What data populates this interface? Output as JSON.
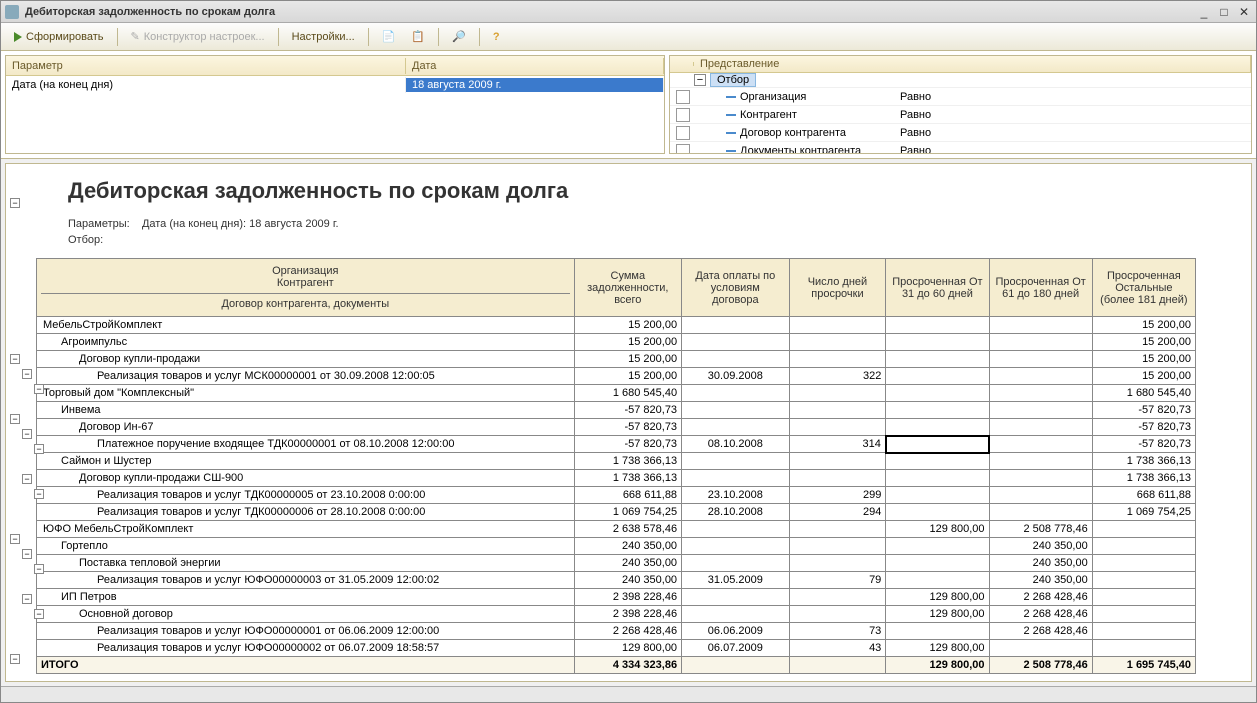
{
  "window": {
    "title": "Дебиторская задолженность по срокам долга"
  },
  "toolbar": {
    "generate": "Сформировать",
    "constructor": "Конструктор настроек...",
    "settings": "Настройки..."
  },
  "params": {
    "header_param": "Параметр",
    "header_date": "Дата",
    "row_label": "Дата (на конец дня)",
    "row_value": "18 августа 2009 г."
  },
  "filters": {
    "header": "Представление",
    "root": "Отбор",
    "items": [
      {
        "label": "Организация",
        "op": "Равно"
      },
      {
        "label": "Контрагент",
        "op": "Равно"
      },
      {
        "label": "Договор контрагента",
        "op": "Равно"
      },
      {
        "label": "Документы контрагента",
        "op": "Равно"
      }
    ]
  },
  "report": {
    "title": "Дебиторская задолженность по срокам долга",
    "params_label": "Параметры:",
    "params_text": "Дата (на конец дня): 18 августа 2009 г.",
    "filter_label": "Отбор:",
    "col_org": "Организация",
    "col_contr": "Контрагент",
    "col_dogdoc": "Договор контрагента, документы",
    "col_sum": "Сумма задолженности, всего",
    "col_paydate": "Дата оплаты по условиям договора",
    "col_days": "Число дней просрочки",
    "col_31_60": "Просроченная От 31 до 60 дней",
    "col_61_180": "Просроченная От 61 до 180 дней",
    "col_rest": "Просроченная Остальные (более 181 дней)",
    "rows": [
      {
        "name": "МебельСтройКомплект",
        "sum": "15 200,00",
        "date": "",
        "days": "",
        "c1": "",
        "c2": "",
        "c3": "15 200,00",
        "ind": 0
      },
      {
        "name": "Агроимпульс",
        "sum": "15 200,00",
        "date": "",
        "days": "",
        "c1": "",
        "c2": "",
        "c3": "15 200,00",
        "ind": 1
      },
      {
        "name": "Договор купли-продажи",
        "sum": "15 200,00",
        "date": "",
        "days": "",
        "c1": "",
        "c2": "",
        "c3": "15 200,00",
        "ind": 2
      },
      {
        "name": "Реализация товаров и услуг МСК00000001 от 30.09.2008 12:00:05",
        "sum": "15 200,00",
        "date": "30.09.2008",
        "days": "322",
        "c1": "",
        "c2": "",
        "c3": "15 200,00",
        "ind": 3
      },
      {
        "name": "Торговый дом \"Комплексный\"",
        "sum": "1 680 545,40",
        "date": "",
        "days": "",
        "c1": "",
        "c2": "",
        "c3": "1 680 545,40",
        "ind": 0
      },
      {
        "name": "Инвема",
        "sum": "-57 820,73",
        "date": "",
        "days": "",
        "c1": "",
        "c2": "",
        "c3": "-57 820,73",
        "ind": 1
      },
      {
        "name": "Договор Ин-67",
        "sum": "-57 820,73",
        "date": "",
        "days": "",
        "c1": "",
        "c2": "",
        "c3": "-57 820,73",
        "ind": 2
      },
      {
        "name": "Платежное поручение входящее ТДК00000001 от 08.10.2008 12:00:00",
        "sum": "-57 820,73",
        "date": "08.10.2008",
        "days": "314",
        "c1": "",
        "c2": "",
        "c3": "-57 820,73",
        "ind": 3,
        "sel": true
      },
      {
        "name": "Саймон и Шустер",
        "sum": "1 738 366,13",
        "date": "",
        "days": "",
        "c1": "",
        "c2": "",
        "c3": "1 738 366,13",
        "ind": 1
      },
      {
        "name": "Договор купли-продажи СШ-900",
        "sum": "1 738 366,13",
        "date": "",
        "days": "",
        "c1": "",
        "c2": "",
        "c3": "1 738 366,13",
        "ind": 2
      },
      {
        "name": "Реализация товаров и услуг ТДК00000005 от 23.10.2008 0:00:00",
        "sum": "668 611,88",
        "date": "23.10.2008",
        "days": "299",
        "c1": "",
        "c2": "",
        "c3": "668 611,88",
        "ind": 3
      },
      {
        "name": "Реализация товаров и услуг ТДК00000006 от 28.10.2008 0:00:00",
        "sum": "1 069 754,25",
        "date": "28.10.2008",
        "days": "294",
        "c1": "",
        "c2": "",
        "c3": "1 069 754,25",
        "ind": 3
      },
      {
        "name": "ЮФО МебельСтройКомплект",
        "sum": "2 638 578,46",
        "date": "",
        "days": "",
        "c1": "129 800,00",
        "c2": "2 508 778,46",
        "c3": "",
        "ind": 0
      },
      {
        "name": "Гортепло",
        "sum": "240 350,00",
        "date": "",
        "days": "",
        "c1": "",
        "c2": "240 350,00",
        "c3": "",
        "ind": 1
      },
      {
        "name": "Поставка тепловой энергии",
        "sum": "240 350,00",
        "date": "",
        "days": "",
        "c1": "",
        "c2": "240 350,00",
        "c3": "",
        "ind": 2
      },
      {
        "name": "Реализация товаров и услуг ЮФО00000003 от 31.05.2009 12:00:02",
        "sum": "240 350,00",
        "date": "31.05.2009",
        "days": "79",
        "c1": "",
        "c2": "240 350,00",
        "c3": "",
        "ind": 3
      },
      {
        "name": "ИП Петров",
        "sum": "2 398 228,46",
        "date": "",
        "days": "",
        "c1": "129 800,00",
        "c2": "2 268 428,46",
        "c3": "",
        "ind": 1
      },
      {
        "name": "Основной договор",
        "sum": "2 398 228,46",
        "date": "",
        "days": "",
        "c1": "129 800,00",
        "c2": "2 268 428,46",
        "c3": "",
        "ind": 2
      },
      {
        "name": "Реализация товаров и услуг ЮФО00000001 от 06.06.2009 12:00:00",
        "sum": "2 268 428,46",
        "date": "06.06.2009",
        "days": "73",
        "c1": "",
        "c2": "2 268 428,46",
        "c3": "",
        "ind": 3
      },
      {
        "name": "Реализация товаров и услуг ЮФО00000002 от 06.07.2009 18:58:57",
        "sum": "129 800,00",
        "date": "06.07.2009",
        "days": "43",
        "c1": "129 800,00",
        "c2": "",
        "c3": "",
        "ind": 3
      }
    ],
    "total": {
      "label": "ИТОГО",
      "sum": "4 334 323,86",
      "c1": "129 800,00",
      "c2": "2 508 778,46",
      "c3": "1 695 745,40"
    }
  }
}
